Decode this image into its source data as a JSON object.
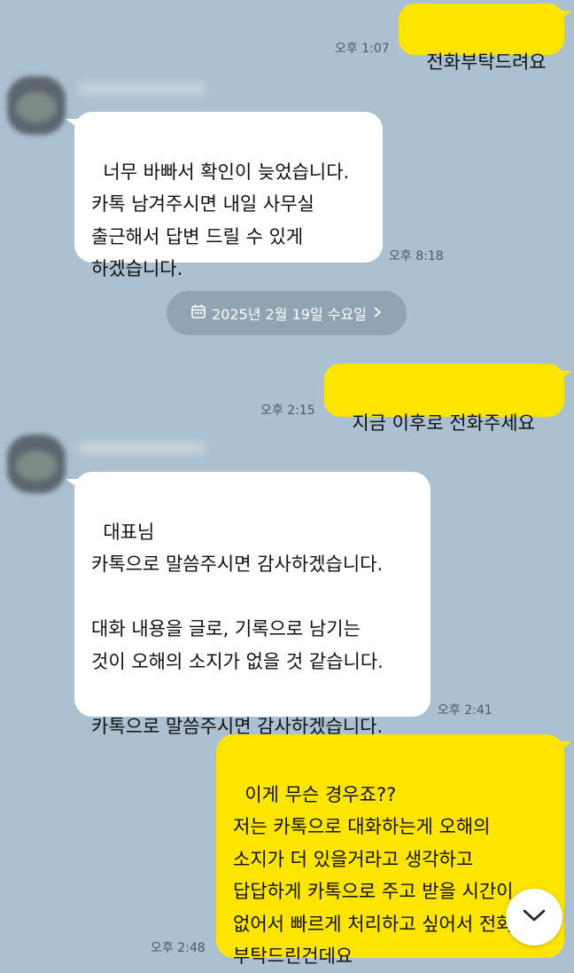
{
  "messages": [
    {
      "id": "m1",
      "dir": "out",
      "text": "전화부탁드려요",
      "time": "오후 1:07"
    },
    {
      "id": "m2",
      "dir": "in",
      "text": "너무 바빠서 확인이 늦었습니다.\n카톡 남겨주시면 내일 사무실\n출근해서 답변 드릴 수 있게\n하겠습니다.",
      "time": "오후 8:18"
    },
    {
      "id": "m3",
      "dir": "out",
      "text": "지금 이후로 전화주세요",
      "time": "오후 2:15"
    },
    {
      "id": "m4",
      "dir": "in",
      "text": "대표님\n카톡으로 말씀주시면 감사하겠습니다.\n\n대화 내용을 글로, 기록으로 남기는\n것이 오해의 소지가 없을 것 같습니다.\n\n카톡으로 말씀주시면 감사하겠습니다.",
      "time": "오후 2:41"
    },
    {
      "id": "m5",
      "dir": "out",
      "text": "이게 무슨 경우죠??\n저는 카톡으로 대화하는게 오해의\n소지가 더 있을거라고 생각하고\n답답하게 카톡으로 주고 받을 시간이\n없어서 빠르게 처리하고 싶어서 전화\n부탁드린건데요",
      "time": "오후 2:48"
    }
  ],
  "date_divider": {
    "label": "2025년 2월 19일 수요일",
    "icon": "calendar-icon",
    "chevron": "chevron-right-icon"
  },
  "scroll_button": {
    "icon": "chevron-down-icon"
  },
  "colors": {
    "background": "#abc1d1",
    "outgoing_bubble": "#fee500",
    "incoming_bubble": "#ffffff",
    "date_pill": "#90a4b3"
  }
}
